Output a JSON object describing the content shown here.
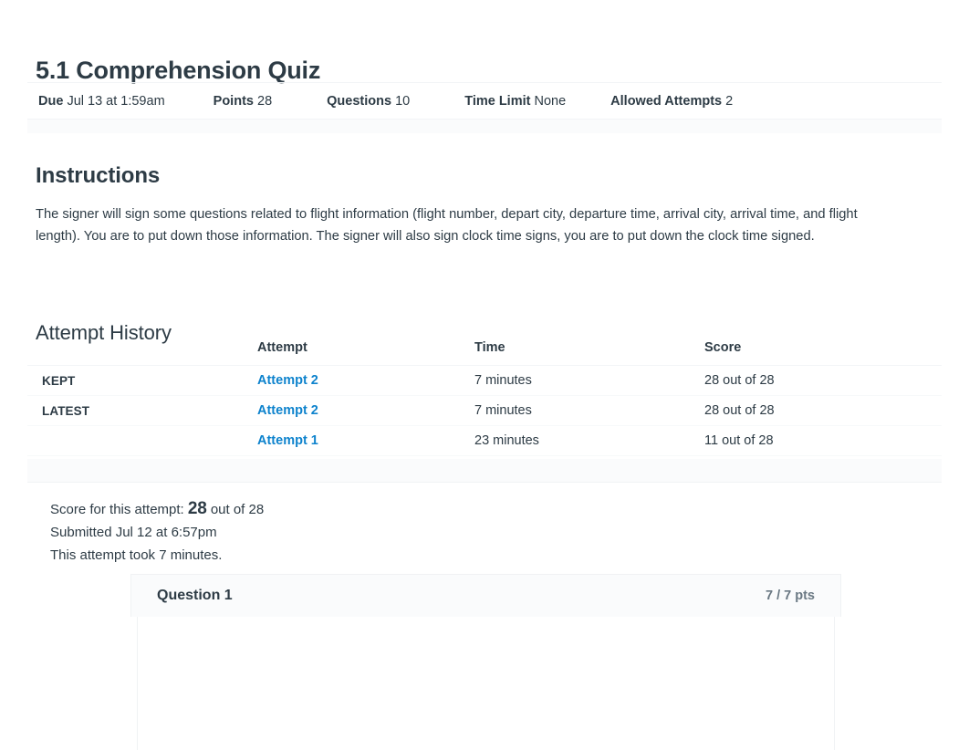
{
  "quiz": {
    "title": "5.1 Comprehension Quiz",
    "info": [
      {
        "label": "Due",
        "value": "Jul 13 at 1:59am"
      },
      {
        "label": "Points",
        "value": "28"
      },
      {
        "label": "Questions",
        "value": "10"
      },
      {
        "label": "Time Limit",
        "value": "None"
      },
      {
        "label": "Allowed Attempts",
        "value": "2"
      }
    ]
  },
  "instructions": {
    "heading": "Instructions",
    "body": "The signer will sign some questions related to flight information (flight number, depart city, departure time, arrival city, arrival time, and flight length). You are to put down those information. The signer will also sign clock time signs, you are to put down the clock time signed."
  },
  "attempt_history": {
    "heading": "Attempt History",
    "columns": {
      "kept": "",
      "attempt": "Attempt",
      "time": "Time",
      "score": "Score"
    },
    "rows": [
      {
        "tag": "KEPT",
        "attempt": "Attempt 2",
        "time": "7 minutes",
        "score": "28 out of 28"
      },
      {
        "tag": "LATEST",
        "attempt": "Attempt 2",
        "time": "7 minutes",
        "score": "28 out of 28"
      },
      {
        "tag": "",
        "attempt": "Attempt 1",
        "time": "23 minutes",
        "score": "11 out of 28"
      }
    ]
  },
  "score_summary": {
    "score_label": "Score for this attempt:",
    "score_value": "28",
    "score_total": "out of 28",
    "submitted": "Submitted Jul 12 at 6:57pm",
    "duration": "This attempt took 7 minutes."
  },
  "question": {
    "name": "Question 1",
    "points": "7 / 7 pts",
    "body": ""
  },
  "colors": {
    "link": "#0e83cd",
    "text": "#2d3b45",
    "muted": "#6a7883",
    "panel": "#fafbfc",
    "border": "#f0f2f4"
  }
}
